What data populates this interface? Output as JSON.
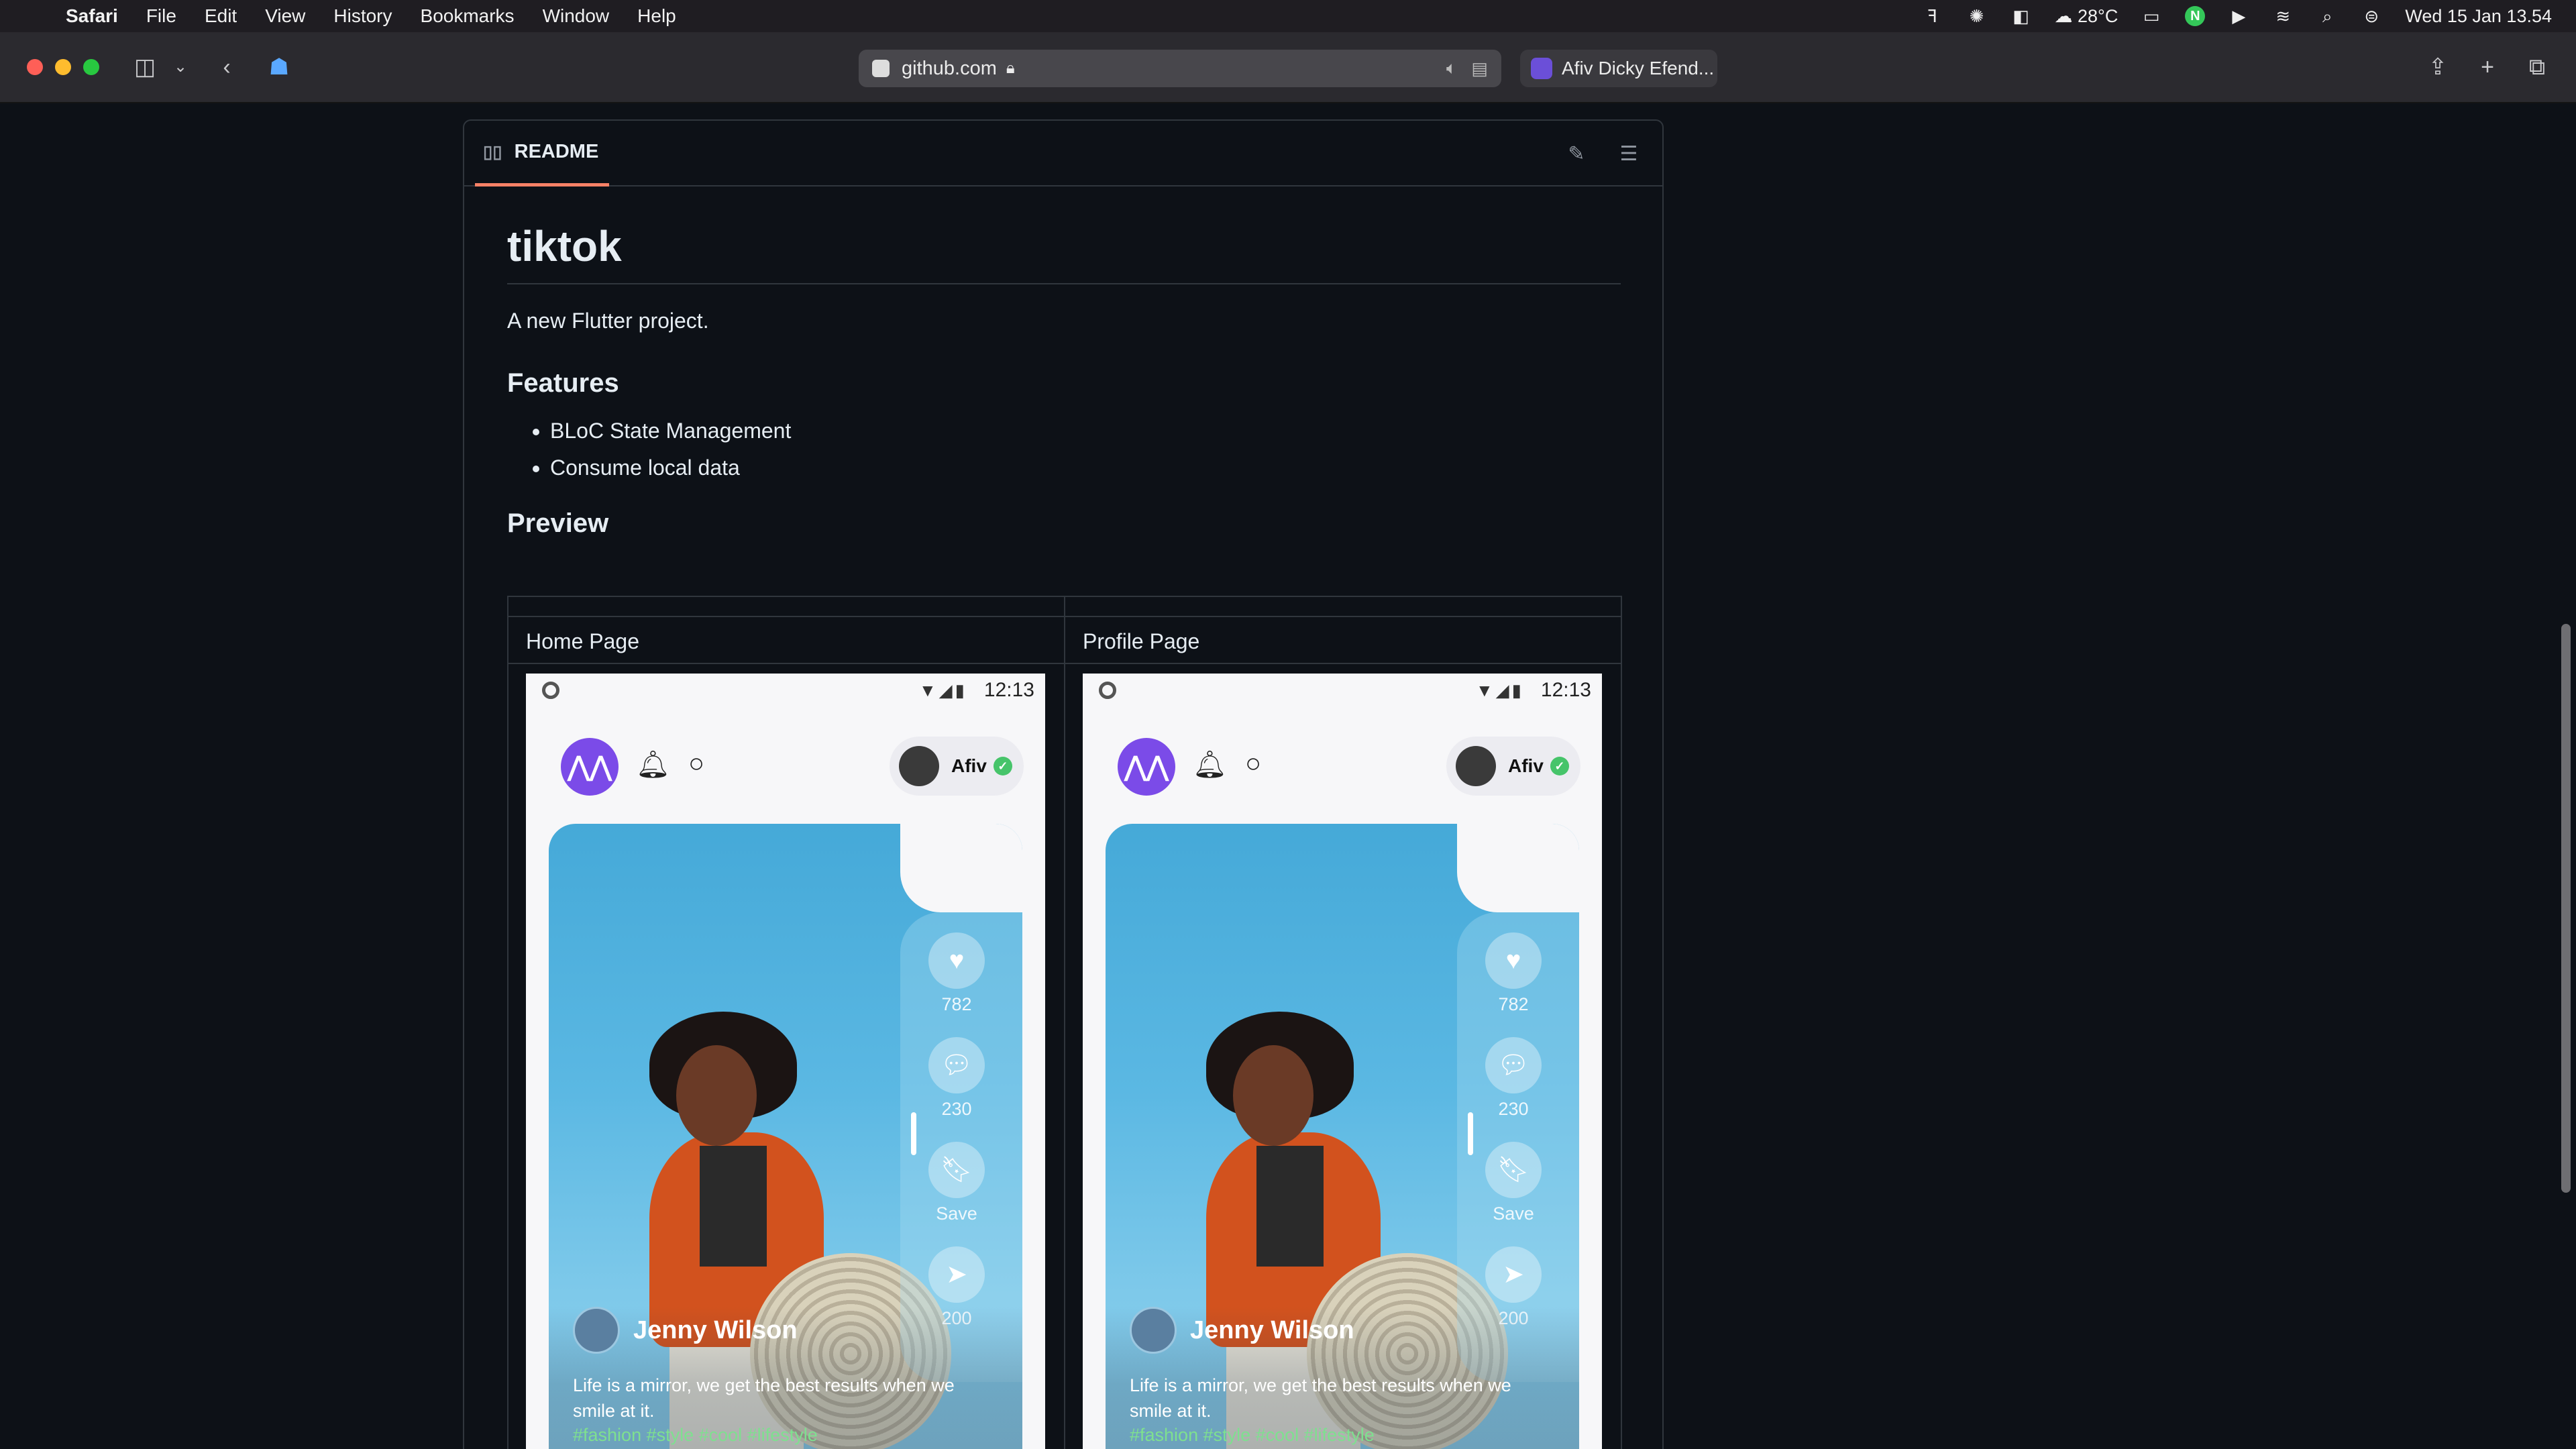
{
  "menubar": {
    "app": "Safari",
    "items": [
      "File",
      "Edit",
      "View",
      "History",
      "Bookmarks",
      "Window",
      "Help"
    ],
    "weather": "28°C",
    "datetime": "Wed 15 Jan  13.54",
    "badge": "N"
  },
  "toolbar": {
    "address": "github.com",
    "tab_title": "Afiv Dicky Efend..."
  },
  "readme": {
    "tab_label": "README",
    "title": "tiktok",
    "description": "A new Flutter project.",
    "features_heading": "Features",
    "features": [
      "BLoC State Management",
      "Consume local data"
    ],
    "preview_heading": "Preview",
    "columns": [
      "Home Page",
      "Profile Page"
    ]
  },
  "phone": {
    "time": "12:13",
    "user_name": "Afiv",
    "likes": "782",
    "comments": "230",
    "save_label": "Save",
    "shares": "200",
    "author": "Jenny Wilson",
    "caption": "Life is a mirror, we get the best results when we smile at it.",
    "tags": "#fashion #style #cool #lifestyle"
  },
  "colors": {
    "accent": "#f78166",
    "brand_purple": "#7b4be8",
    "page_bg": "#0d1117",
    "border": "#30363d"
  }
}
